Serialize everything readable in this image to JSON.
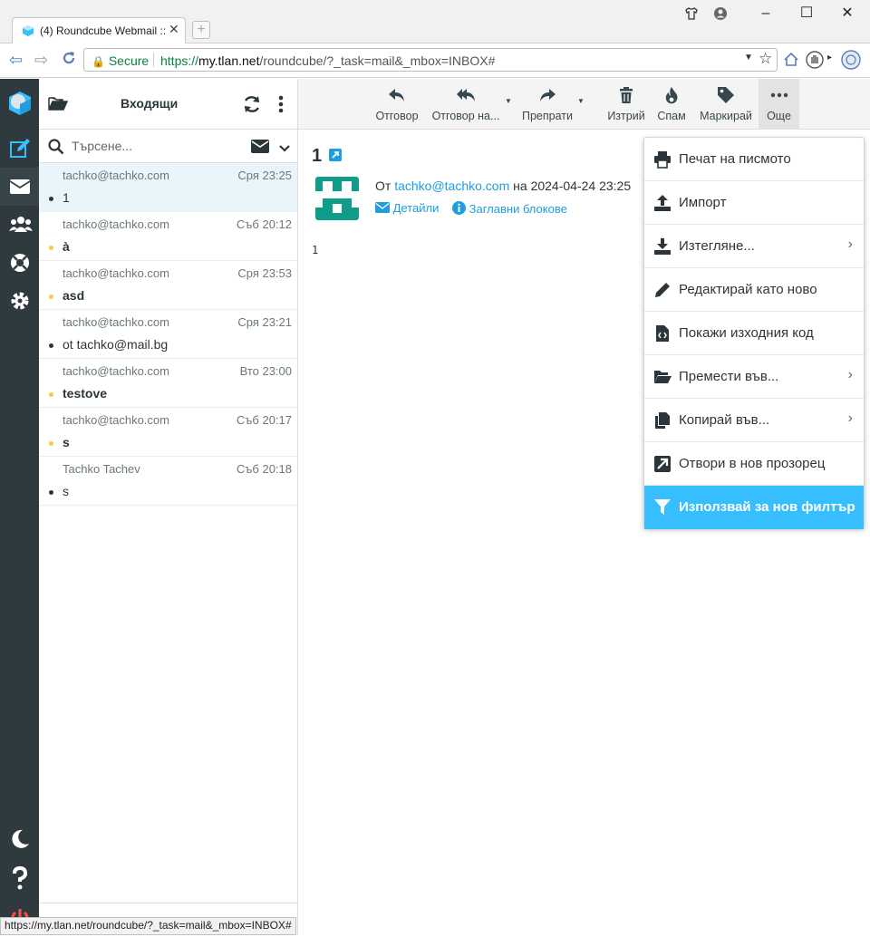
{
  "browser": {
    "tab_title": "(4) Roundcube Webmail ::",
    "secure_label": "Secure",
    "url_proto": "https://",
    "url_host": "my.tlan.net",
    "url_path": "/roundcube/?_task=mail&_mbox=INBOX#",
    "status_url": "https://my.tlan.net/roundcube/?_task=mail&_mbox=INBOX#"
  },
  "list": {
    "folder_title": "Входящи",
    "search_placeholder": "Търсене...",
    "messages": [
      {
        "from": "tachko@tachko.com",
        "date": "Сря 23:25",
        "subject": "1",
        "bold": false,
        "dot": "#2c363a"
      },
      {
        "from": "tachko@tachko.com",
        "date": "Съб 20:12",
        "subject": "à",
        "bold": true,
        "dot": "#ffc93d"
      },
      {
        "from": "tachko@tachko.com",
        "date": "Сря 23:53",
        "subject": "asd",
        "bold": true,
        "dot": "#ffc93d"
      },
      {
        "from": "tachko@tachko.com",
        "date": "Сря 23:21",
        "subject": "ot tachko@mail.bg",
        "bold": false,
        "dot": "#2c363a"
      },
      {
        "from": "tachko@tachko.com",
        "date": "Вто 23:00",
        "subject": "testove",
        "bold": true,
        "dot": "#ffc93d"
      },
      {
        "from": "tachko@tachko.com",
        "date": "Съб 20:17",
        "subject": "s",
        "bold": true,
        "dot": "#ffc93d"
      },
      {
        "from": "Tachko Tachev",
        "date": "Съб 20:18",
        "subject": "s",
        "bold": false,
        "dot": "#2c363a"
      }
    ]
  },
  "toolbar": {
    "reply": "Отговор",
    "reply_all": "Отговор на...",
    "forward": "Препрати",
    "delete": "Изтрий",
    "spam": "Спам",
    "mark": "Маркирай",
    "more": "Още"
  },
  "message": {
    "subject": "1",
    "from_prefix": "От",
    "from_email": "tachko@tachko.com",
    "date_prefix": "на",
    "date": "2024-04-24 23:25",
    "details": "Детайли",
    "headers": "Заглавни блокове",
    "body": "1"
  },
  "menu": {
    "items": [
      {
        "label": "Печат на писмото",
        "icon": "printer-icon"
      },
      {
        "label": "Импорт",
        "icon": "upload-icon"
      },
      {
        "label": "Изтегляне...",
        "icon": "download-icon"
      },
      {
        "label": "Редактирай като ново",
        "icon": "pencil-icon"
      },
      {
        "label": "Покажи изходния код",
        "icon": "code-file-icon"
      },
      {
        "label": "Премести във...",
        "icon": "folder-open-icon"
      },
      {
        "label": "Копирай във...",
        "icon": "copy-icon"
      },
      {
        "label": "Отвори в нов прозорец",
        "icon": "external-link-icon"
      },
      {
        "label": "Използвай за нов филтър",
        "icon": "filter-icon"
      }
    ]
  },
  "colors": {
    "accent": "#37beff",
    "link": "#1e9de0",
    "sidebar": "#2f3a3f",
    "unread_dot": "#ffc93d"
  }
}
